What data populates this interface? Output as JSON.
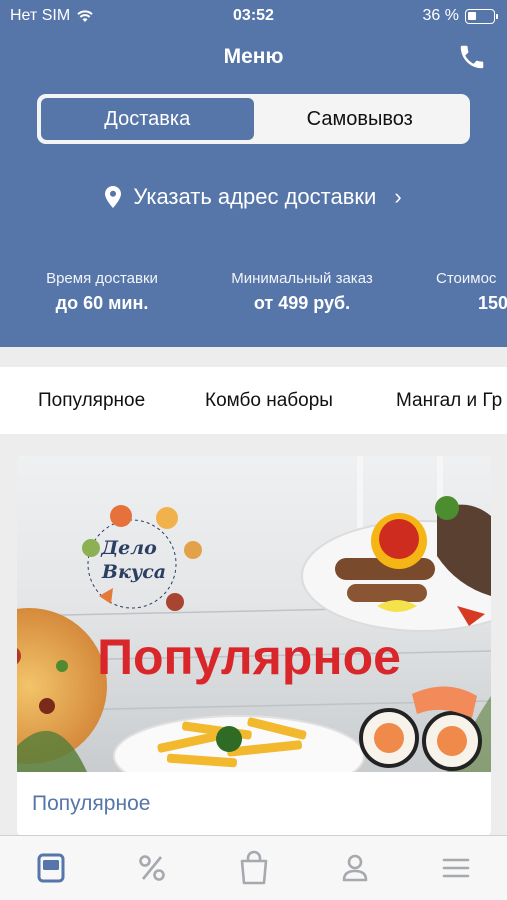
{
  "status": {
    "carrier": "Нет SIM",
    "time": "03:52",
    "battery": "36 %",
    "battery_level": 0.36
  },
  "header": {
    "title": "Меню"
  },
  "delivery_toggle": {
    "options": [
      "Доставка",
      "Самовывоз"
    ],
    "selected": "Доставка"
  },
  "address": {
    "label": "Указать адрес доставки"
  },
  "info": [
    {
      "label": "Время доставки",
      "value": "до 60 мин."
    },
    {
      "label": "Минимальный заказ",
      "value": "от 499 руб."
    },
    {
      "label": "Стоимос",
      "value": "150"
    }
  ],
  "categories": [
    "Популярное",
    "Комбо наборы",
    "Мангал и Гр"
  ],
  "card": {
    "banner_text": "Популярное",
    "logo_text_1": "Дело",
    "logo_text_2": "Вкуса",
    "title": "Популярное"
  },
  "tabbar": {
    "icons": [
      "menu-icon",
      "percent-icon",
      "bag-icon",
      "profile-icon",
      "hamburger-icon"
    ],
    "active": "menu-icon"
  },
  "colors": {
    "accent": "#5676a9",
    "banner_red": "#d9262b"
  }
}
